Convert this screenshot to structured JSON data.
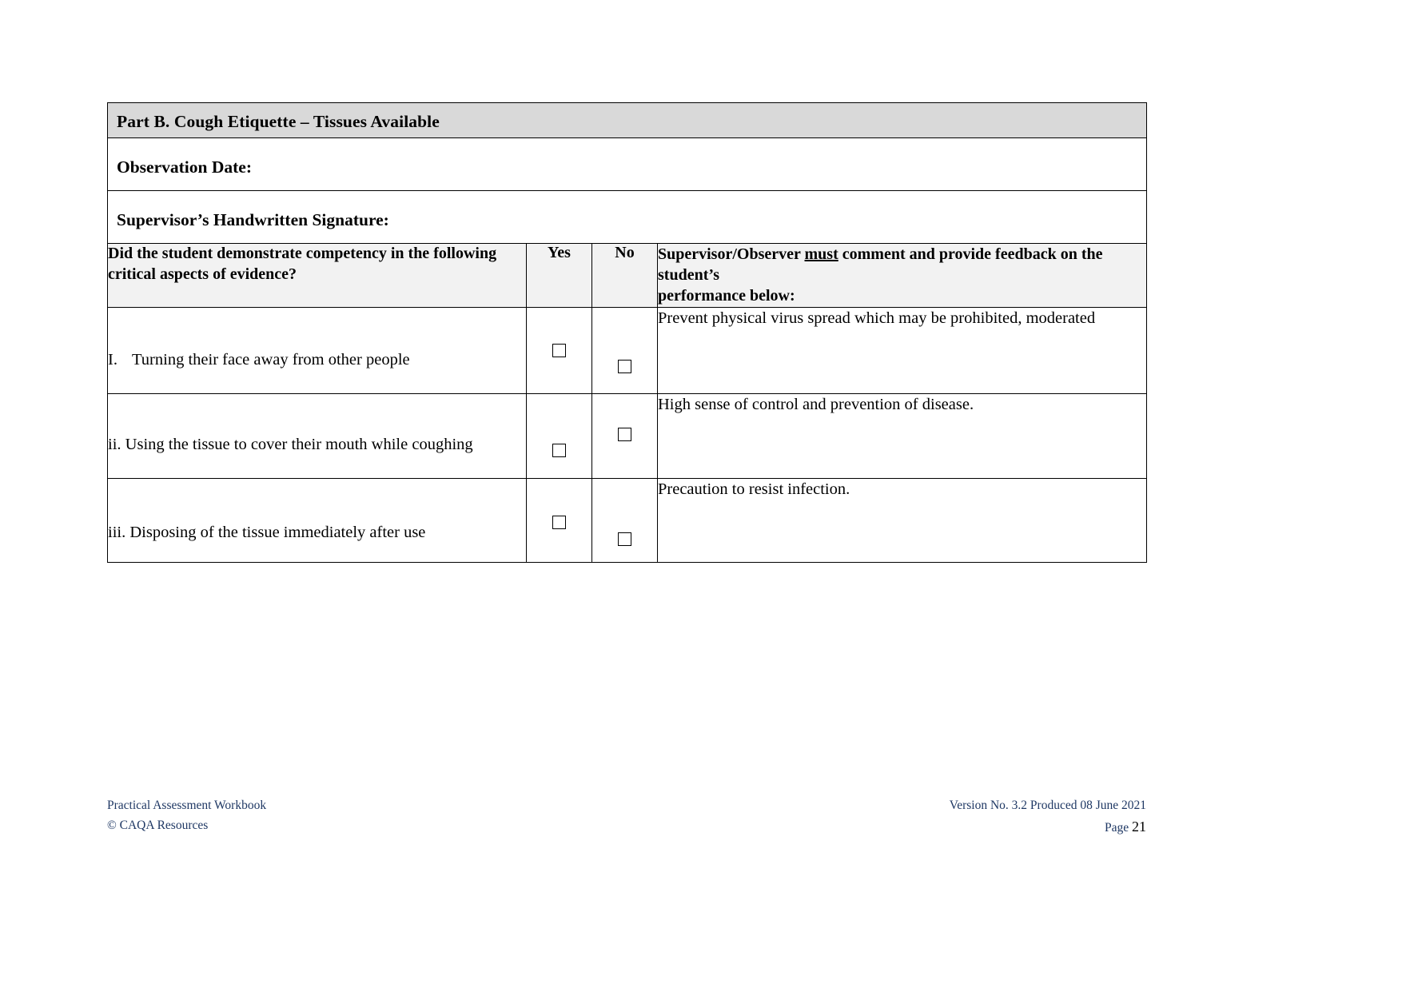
{
  "form": {
    "section_title": "Part B. Cough Etiquette – Tissues Available",
    "observation_date_label": "Observation Date:",
    "signature_label": "Supervisor’s Handwritten Signature:",
    "table": {
      "headers": {
        "question": "Did the student demonstrate competency in the following critical aspects of evidence?",
        "yes": "Yes",
        "no": "No",
        "comment_line1_a": "Supervisor/Observer ",
        "comment_line1_b": "must",
        "comment_line1_c": " comment and provide feedback on the student’s",
        "comment_line2": "performance below:"
      },
      "rows": [
        {
          "roman": "I.",
          "text": "Turning their face away from other people",
          "yes_checked": false,
          "no_checked": false,
          "comment": "Prevent physical virus spread which may be prohibited, moderated"
        },
        {
          "roman": "ii.",
          "text": "Using the tissue to cover their mouth while coughing",
          "yes_checked": false,
          "no_checked": false,
          "comment": "High sense of control and prevention of disease."
        },
        {
          "roman": "iii.",
          "text": "Disposing of the tissue immediately after use",
          "yes_checked": false,
          "no_checked": false,
          "comment": "Precaution to resist infection."
        }
      ]
    }
  },
  "footer": {
    "workbook": "Practical Assessment Workbook",
    "copyright": "© CAQA Resources",
    "version": "Version No. 3.2 Produced 08 June 2021",
    "page_label": "Page",
    "page_number": "21"
  },
  "colors": {
    "title_bar": "#d9d9d9",
    "header_row": "#f2f2f2",
    "footer_text": "#1f3864",
    "border": "#000000"
  }
}
